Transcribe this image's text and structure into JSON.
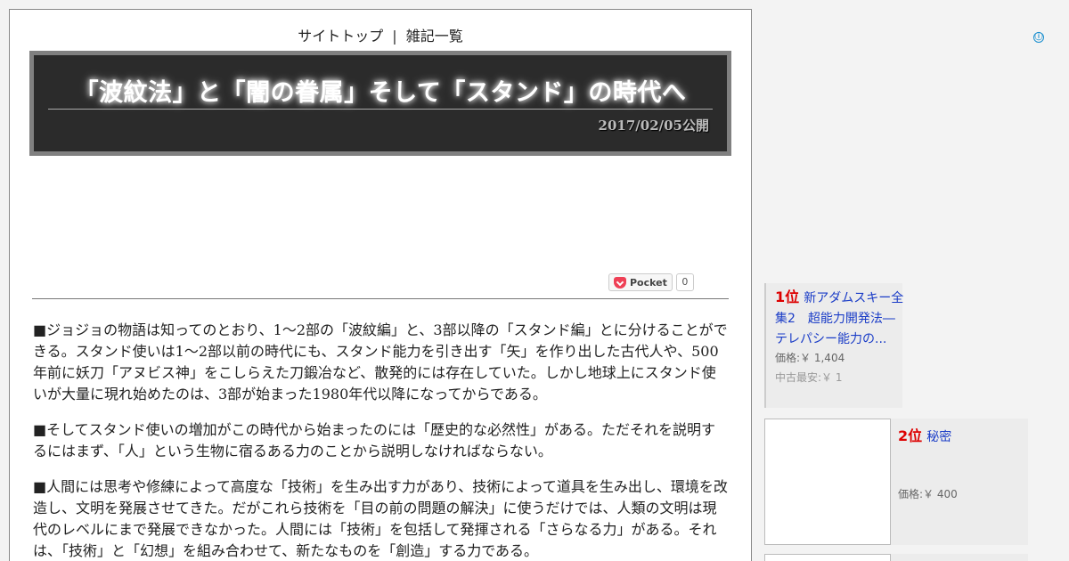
{
  "nav": {
    "site_top": "サイトトップ",
    "separator": "|",
    "misc_list": "雑記一覧"
  },
  "article": {
    "title": "「波紋法」と「闇の眷属」そして「スタンド」の時代へ",
    "date": "2017/02/05公開",
    "paragraphs": [
      "■ジョジョの物語は知ってのとおり、1～2部の「波紋編」と、3部以降の「スタンド編」とに分けることができる。スタンド使いは1～2部以前の時代にも、スタンド能力を引き出す「矢」を作り出した古代人や、500年前に妖刀「アヌビス神」をこしらえた刀鍛冶など、散発的には存在していた。しかし地球上にスタンド使いが大量に現れ始めたのは、3部が始まった1980年代以降になってからである。",
      "■そしてスタンド使いの増加がこの時代から始まったのには「歴史的な必然性」がある。ただそれを説明するにはまず、「人」という生物に宿るある力のことから説明しなければならない。",
      "■人間には思考や修練によって高度な「技術」を生み出す力があり、技術によって道具を生み出し、環境を改造し、文明を発展させてきた。だがこれら技術を「目の前の問題の解決」に使うだけでは、人類の文明は現代のレベルにまで発展できなかった。人間には「技術」を包括して発揮される「さらなる力」がある。それは、「技術」と「幻想」を組み合わせて、新たなものを「創造」する力である。"
    ]
  },
  "pocket": {
    "label": "Pocket",
    "count": "0"
  },
  "ranking": [
    {
      "rank": "1位",
      "title": "新アダムスキー全集2　超能力開発法―テレパシー能力の...",
      "price": "価格:￥ 1,404",
      "used": "中古最安:￥ 1"
    },
    {
      "rank": "2位",
      "title": "秘密",
      "price": "価格:￥ 400"
    }
  ],
  "ad_info_icon": "ⓘ"
}
